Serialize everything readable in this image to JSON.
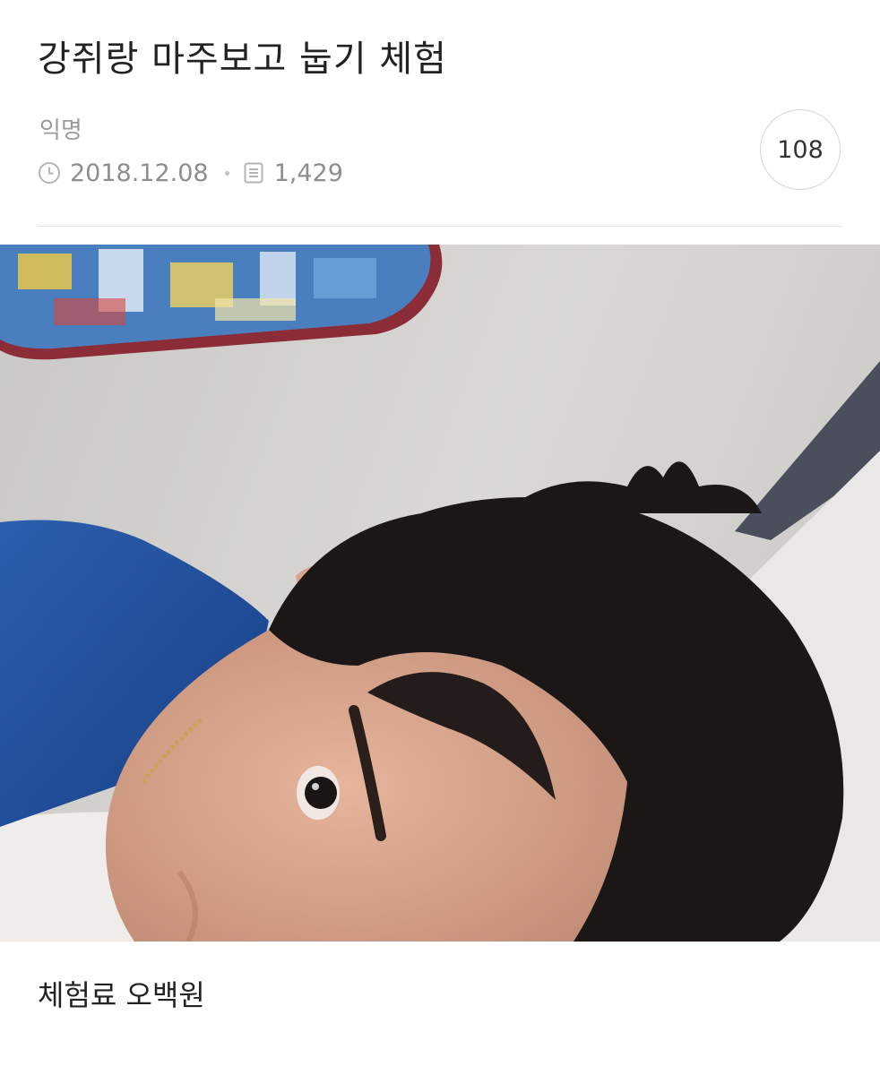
{
  "post": {
    "title": "강쥐랑 마주보고 눕기 체험",
    "author": "익명",
    "date": "2018.12.08",
    "views": "1,429",
    "count": "108",
    "caption": "체험료 오백원"
  },
  "icons": {
    "date": "clock-icon",
    "views": "document-icon"
  },
  "colors": {
    "title": "#222222",
    "meta": "#8e8e8e",
    "divider": "#e4e4e4"
  }
}
